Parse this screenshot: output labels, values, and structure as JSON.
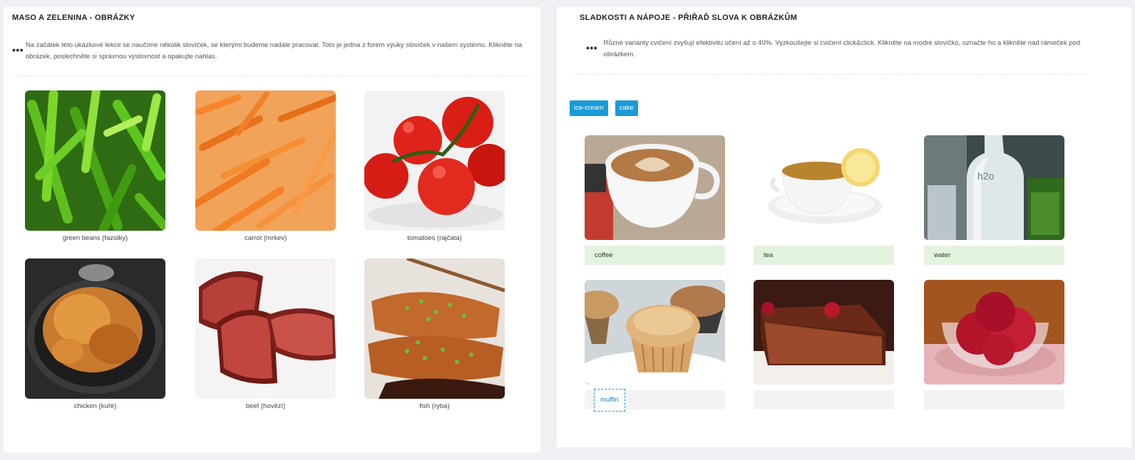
{
  "left": {
    "title": "MASO A ZELENINA - OBRÁZKY",
    "intro": "Na začátek této ukázkové lekce se naučíme několik slovíček, se kterými budeme nadále pracovat. Toto je jedna z forem výuky slovíček v našem systému. Klikněte na obrázek, poslechněte si správnou výslovnost a opakujte nahlas.",
    "items": [
      {
        "caption": "green beans (fazolky)",
        "image": "green-beans-photo"
      },
      {
        "caption": "carrot (mrkev)",
        "image": "carrot-photo"
      },
      {
        "caption": "tomatoes (rajčata)",
        "image": "tomatoes-photo"
      },
      {
        "caption": "chicken (kuře)",
        "image": "chicken-photo"
      },
      {
        "caption": "beef (hovězí)",
        "image": "beef-photo"
      },
      {
        "caption": "fish (ryba)",
        "image": "fish-photo"
      }
    ]
  },
  "right": {
    "title": "SLADKOSTI A NÁPOJE - PŘIŘAĎ SLOVA K OBRÁZKŮM",
    "intro": "Různé varianty cvičení zvyšují efektivitu učení až o 40%. Vyzkoušejte si cvičení click&click. Klikněte na modré slovíčko, označte ho a klikněte nad rámeček pod obrázkem.",
    "word_bank": [
      "ice-cream",
      "cake"
    ],
    "items": [
      {
        "answer": "coffee",
        "state": "correct",
        "image": "coffee-photo"
      },
      {
        "answer": "tea",
        "state": "correct",
        "image": "tea-photo"
      },
      {
        "answer": "water",
        "state": "correct",
        "image": "water-photo"
      },
      {
        "answer": "muffin",
        "state": "placed",
        "image": "muffin-photo"
      },
      {
        "answer": "",
        "state": "empty",
        "image": "cake-photo"
      },
      {
        "answer": "",
        "state": "empty",
        "image": "ice-cream-photo"
      }
    ]
  },
  "colors": {
    "accent": "#1a9ad6",
    "correct_bg": "#e4f3dd",
    "empty_bg": "#f3f3f3"
  }
}
